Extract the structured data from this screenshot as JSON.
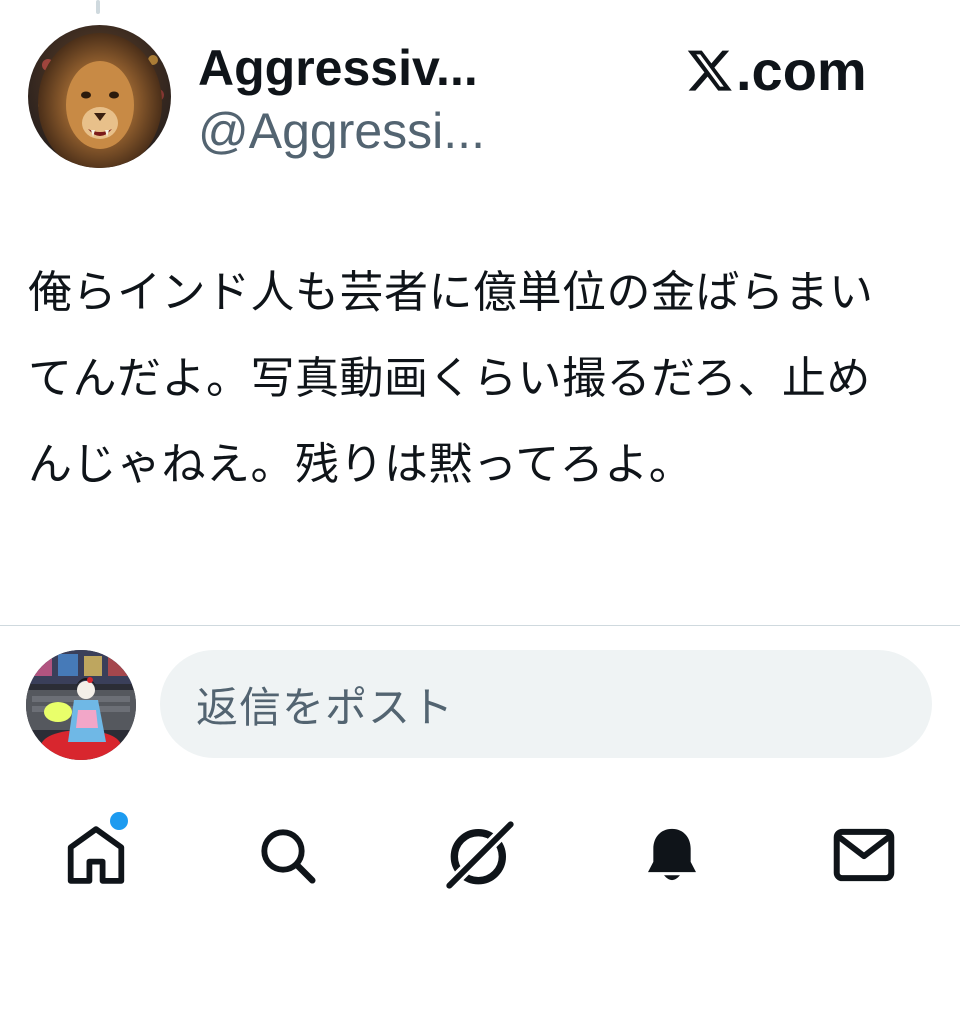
{
  "post": {
    "display_name": "Aggressiv...",
    "handle": "@Aggressi...",
    "brand": ".com",
    "brand_icon": "x-logo-icon",
    "text": "俺らインド人も芸者に億単位の金ばらまいてんだよ。写真動画くらい撮るだろ、止めんじゃねえ。残りは黙ってろよ。",
    "avatar_icon": "lion-avatar"
  },
  "reply": {
    "placeholder": "返信をポスト",
    "avatar_icon": "geisha-doll-avatar"
  },
  "tabbar": {
    "items": [
      {
        "icon": "home-icon",
        "has_notification_dot": true
      },
      {
        "icon": "search-icon"
      },
      {
        "icon": "grok-icon"
      },
      {
        "icon": "bell-icon"
      },
      {
        "icon": "mail-icon"
      }
    ]
  },
  "colors": {
    "text_primary": "#0f1419",
    "text_secondary": "#536471",
    "divider": "#cfd9de",
    "input_background": "#eff3f4",
    "accent_blue": "#1d9bf0"
  }
}
